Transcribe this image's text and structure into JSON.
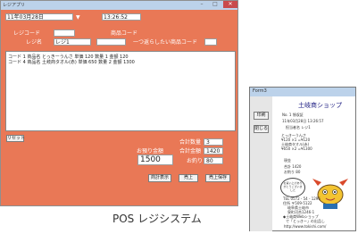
{
  "main_window": {
    "title": "レジアプリ",
    "date": "11年03月28日",
    "time": "13:26:52",
    "dropdown_glyph": "▼",
    "fields": {
      "register_code_label": "レジコード",
      "product_code_label": "商品コード",
      "register_name_label": "レジ名",
      "register_name_value": "レジ1",
      "oneline_label": "一つ返らしたい商品コード"
    },
    "list_lines": [
      "コード 1 商品名 とっきーうんさ 単価 120 数量 1 金額 120",
      "コード 4 商品名 土岐商タオル(赤) 単価 650 数量 2 金額 1300"
    ],
    "reset_label": "リセット",
    "total_qty_label": "合計数量",
    "total_qty_value": "3",
    "total_amount_label": "合計金額",
    "total_amount_value": "1420",
    "received_label": "お預り金額",
    "received_value": "1500",
    "change_label": "お釣り",
    "change_value": "80",
    "buttons": [
      "商計表示",
      "売上",
      "売上保存"
    ],
    "window_buttons": [
      "–",
      "□",
      "✕"
    ]
  },
  "receipt_window": {
    "title": "Form3",
    "print_button": "印刷",
    "close_button": "閉じる",
    "shop_name": "土岐商ショップ",
    "receipt_no": "No. 1  領収証",
    "datetime": "11年03月28日  13:26:57",
    "staff": "担当者名  レジ1",
    "items": [
      "とっきーうんさ",
      "¥120 ×1 =¥120",
      "土岐商タオル(赤)",
      "¥650 ×2 =¥1300"
    ],
    "cash_label": "現金",
    "total_line": "合計  1420",
    "change_line": "お釣り  80",
    "bubble_text": "お買い上げありがとうございました",
    "footer": [
      "TEL 0572 - 54 - 1296",
      "住所 〒509-5122",
      "岐阜県土岐市",
      "泉町河合1246-1",
      "◆土岐商Webショップ",
      "で「とっきー」の出品し",
      "http://www.tokishi.com/"
    ]
  },
  "caption": "POS レジシステム",
  "colors": {
    "window_bg": "#e97856",
    "titlebar": "#bcd2ea",
    "shop_name": "#1a1a80"
  }
}
